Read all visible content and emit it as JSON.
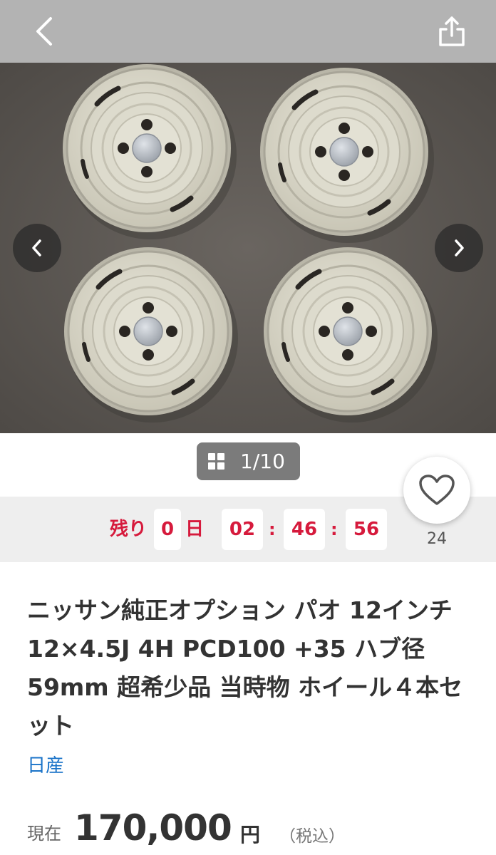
{
  "gallery": {
    "counter": "1/10"
  },
  "countdown": {
    "remaining_label": "残り",
    "days": "0",
    "day_unit": "日",
    "hours": "02",
    "minutes": "46",
    "seconds": "56",
    "separator": ":"
  },
  "watch": {
    "count": "24"
  },
  "item": {
    "title": "ニッサン純正オプション パオ 12インチ 12×4.5J 4H PCD100 +35 ハブ径59mm 超希少品 当時物 ホイール４本セット",
    "brand": "日産"
  },
  "price": {
    "label": "現在",
    "value": "170,000",
    "unit": "円",
    "tax_note": "（税込）"
  },
  "icons": {
    "back": "chevron-left-icon",
    "share": "share-icon",
    "prev": "chevron-left-icon",
    "next": "chevron-right-icon",
    "gallery": "grid-icon",
    "watch": "heart-icon"
  },
  "colors": {
    "countdown_red": "#d61a3c",
    "link_blue": "#1a73c8",
    "header_gray": "#b3b3b3"
  }
}
